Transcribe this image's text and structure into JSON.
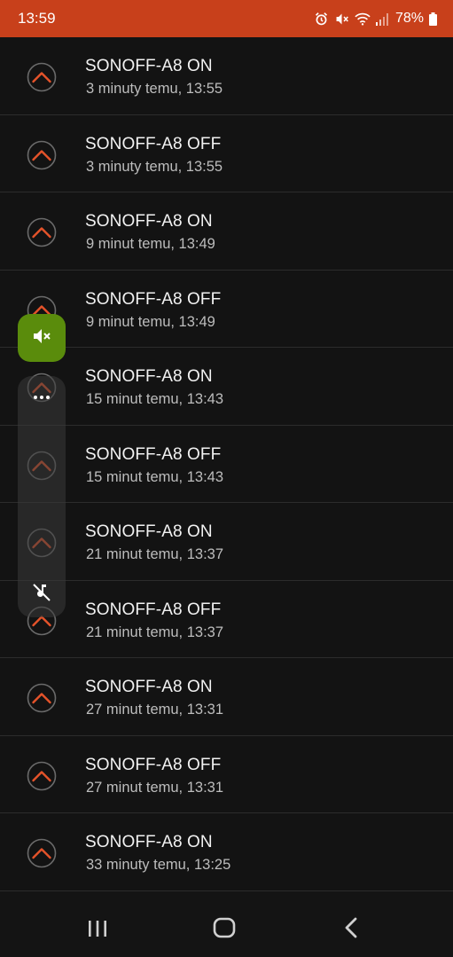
{
  "status": {
    "time": "13:59",
    "battery": "78%"
  },
  "notifications": [
    {
      "title": "SONOFF-A8 ON",
      "subtitle": "3 minuty temu, 13:55"
    },
    {
      "title": "SONOFF-A8 OFF",
      "subtitle": "3 minuty temu, 13:55"
    },
    {
      "title": "SONOFF-A8 ON",
      "subtitle": "9 minut temu, 13:49"
    },
    {
      "title": "SONOFF-A8 OFF",
      "subtitle": "9 minut temu, 13:49"
    },
    {
      "title": "SONOFF-A8 ON",
      "subtitle": "15 minut temu, 13:43"
    },
    {
      "title": "SONOFF-A8 OFF",
      "subtitle": "15 minut temu, 13:43"
    },
    {
      "title": "SONOFF-A8 ON",
      "subtitle": "21 minut temu, 13:37"
    },
    {
      "title": "SONOFF-A8 OFF",
      "subtitle": "21 minut temu, 13:37"
    },
    {
      "title": "SONOFF-A8 ON",
      "subtitle": "27 minut temu, 13:31"
    },
    {
      "title": "SONOFF-A8 OFF",
      "subtitle": "27 minut temu, 13:31"
    },
    {
      "title": "SONOFF-A8 ON",
      "subtitle": "33 minuty temu, 13:25"
    }
  ],
  "icons": {
    "notification": "chevron-up-icon",
    "alarm": "alarm-icon",
    "mute": "mute-icon",
    "wifi": "wifi-icon",
    "signal": "signal-icon",
    "battery": "battery-icon",
    "more": "more-icon",
    "ringtone_off": "ringtone-off-icon",
    "recents": "recents-icon",
    "home": "home-icon",
    "back": "back-icon"
  },
  "colors": {
    "status_bar": "#c8401b",
    "accent": "#e5532a",
    "background": "#131313",
    "mute_active": "#5a8c0c"
  }
}
